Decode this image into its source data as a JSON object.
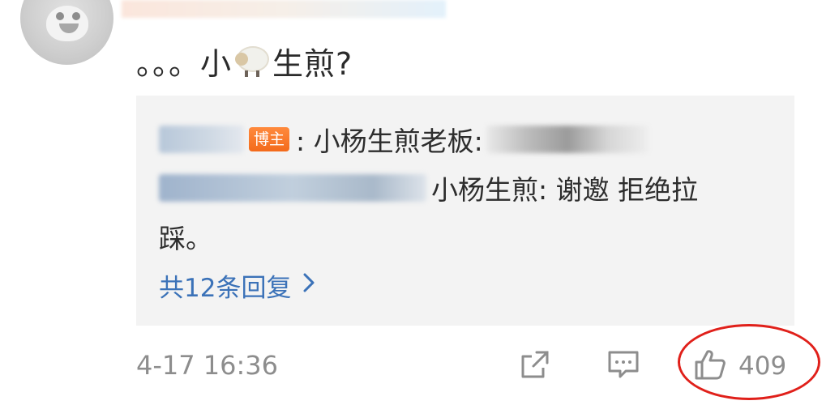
{
  "comment": {
    "prefix": "。。。小",
    "emoji": "sheep-emoji",
    "suffix": "生煎?"
  },
  "replies": {
    "line1": {
      "badge": "博主",
      "text": ": 小杨生煎老板: "
    },
    "line2": {
      "text": " 小杨生煎: 谢邀 拒绝拉"
    },
    "line3": {
      "text": "踩。"
    },
    "more_label": "共12条回复",
    "more_icon": "chevron-right-icon"
  },
  "footer": {
    "timestamp": "4-17 16:36",
    "share_icon": "share-icon",
    "comment_icon": "comment-icon",
    "like_icon": "thumbs-up-icon",
    "like_count": "409"
  },
  "colors": {
    "link": "#3b72b8",
    "badge": "#f36a1b",
    "highlight": "#e0201a",
    "reply_bg": "#f3f3f3"
  }
}
